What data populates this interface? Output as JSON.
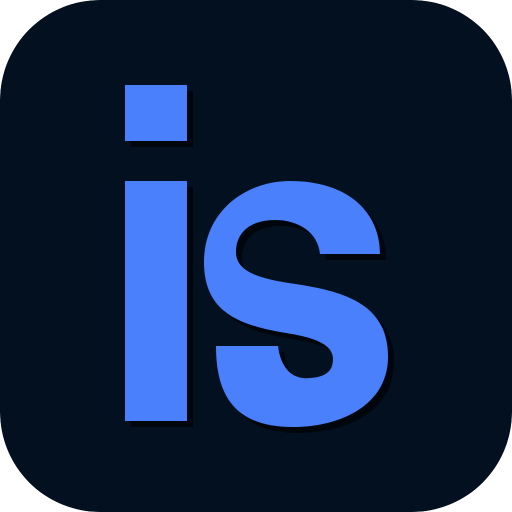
{
  "app_icon": {
    "logo_text": "is",
    "colors": {
      "background": "#03101f",
      "letters": "#4a80fb",
      "shadow": "#000000"
    }
  }
}
